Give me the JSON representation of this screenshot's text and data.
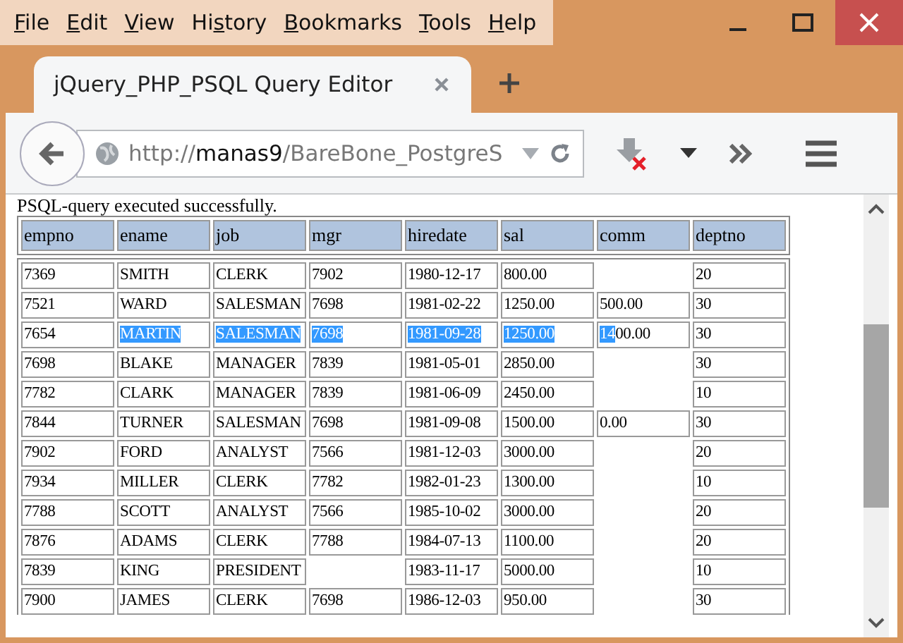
{
  "window": {
    "menu": [
      {
        "label_parts": [
          {
            "text": "F",
            "underlined": true
          },
          {
            "text": "ile",
            "underlined": false
          }
        ]
      },
      {
        "label_parts": [
          {
            "text": "E",
            "underlined": true
          },
          {
            "text": "dit",
            "underlined": false
          }
        ]
      },
      {
        "label_parts": [
          {
            "text": "V",
            "underlined": true
          },
          {
            "text": "iew",
            "underlined": false
          }
        ]
      },
      {
        "label_parts": [
          {
            "text": "Hi",
            "underlined": false
          },
          {
            "text": "s",
            "underlined": true
          },
          {
            "text": "tory",
            "underlined": false
          }
        ]
      },
      {
        "label_parts": [
          {
            "text": "B",
            "underlined": true
          },
          {
            "text": "ookmarks",
            "underlined": false
          }
        ]
      },
      {
        "label_parts": [
          {
            "text": "T",
            "underlined": true
          },
          {
            "text": "ools",
            "underlined": false
          }
        ]
      },
      {
        "label_parts": [
          {
            "text": "H",
            "underlined": true
          },
          {
            "text": "elp",
            "underlined": false
          }
        ]
      }
    ]
  },
  "tabs": [
    {
      "label": "jQuery_PHP_PSQL Query Editor",
      "selected": true
    }
  ],
  "address_bar": {
    "scheme": "http://",
    "host": "manas9",
    "path": "/BareBone_PostgreS"
  },
  "page": {
    "message": "PSQL-query executed successfully.",
    "table": {
      "columns": [
        "empno",
        "ename",
        "job",
        "mgr",
        "hiredate",
        "sal",
        "comm",
        "deptno"
      ],
      "rows": [
        [
          "7369",
          "SMITH",
          "CLERK",
          "7902",
          "1980-12-17",
          "800.00",
          null,
          "20"
        ],
        [
          "7521",
          "WARD",
          "SALESMAN",
          "7698",
          "1981-02-22",
          "1250.00",
          "500.00",
          "30"
        ],
        [
          {
            "segments": [
              {
                "text": "7654",
                "selected": false
              }
            ]
          },
          {
            "segments": [
              {
                "text": "MARTIN",
                "selected": true
              }
            ]
          },
          {
            "segments": [
              {
                "text": "SALESMAN",
                "selected": true
              }
            ]
          },
          {
            "segments": [
              {
                "text": "7698",
                "selected": true
              }
            ]
          },
          {
            "segments": [
              {
                "text": "1981-09-28",
                "selected": true
              }
            ]
          },
          {
            "segments": [
              {
                "text": "1250.00",
                "selected": true
              }
            ]
          },
          {
            "segments": [
              {
                "text": "14",
                "selected": true
              },
              {
                "text": "00.00",
                "selected": false
              }
            ]
          },
          {
            "segments": [
              {
                "text": "30",
                "selected": false
              }
            ]
          }
        ],
        [
          "7698",
          "BLAKE",
          "MANAGER",
          "7839",
          "1981-05-01",
          "2850.00",
          null,
          "30"
        ],
        [
          "7782",
          "CLARK",
          "MANAGER",
          "7839",
          "1981-06-09",
          "2450.00",
          null,
          "10"
        ],
        [
          "7844",
          "TURNER",
          "SALESMAN",
          "7698",
          "1981-09-08",
          "1500.00",
          "0.00",
          "30"
        ],
        [
          "7902",
          "FORD",
          "ANALYST",
          "7566",
          "1981-12-03",
          "3000.00",
          null,
          "20"
        ],
        [
          "7934",
          "MILLER",
          "CLERK",
          "7782",
          "1982-01-23",
          "1300.00",
          null,
          "10"
        ],
        [
          "7788",
          "SCOTT",
          "ANALYST",
          "7566",
          "1985-10-02",
          "3000.00",
          null,
          "20"
        ],
        [
          "7876",
          "ADAMS",
          "CLERK",
          "7788",
          "1984-07-13",
          "1100.00",
          null,
          "20"
        ],
        [
          "7839",
          "KING",
          "PRESIDENT",
          null,
          "1983-11-17",
          "5000.00",
          null,
          "10"
        ],
        [
          "7900",
          "JAMES",
          "CLERK",
          "7698",
          "1986-12-03",
          "950.00",
          null,
          "30"
        ]
      ]
    }
  }
}
